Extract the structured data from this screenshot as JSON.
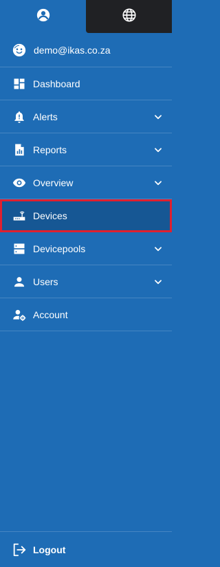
{
  "tabs": [
    {
      "icon": "account-circle-icon"
    },
    {
      "icon": "globe-icon"
    }
  ],
  "user": {
    "email": "demo@ikas.co.za",
    "icon": "smiley-avatar-icon"
  },
  "nav": {
    "items": [
      {
        "label": "Dashboard",
        "icon": "dashboard-icon",
        "expandable": false
      },
      {
        "label": "Alerts",
        "icon": "bell-alert-icon",
        "expandable": true
      },
      {
        "label": "Reports",
        "icon": "report-document-icon",
        "expandable": true
      },
      {
        "label": "Overview",
        "icon": "eye-icon",
        "expandable": true
      },
      {
        "label": "Devices",
        "icon": "router-icon",
        "expandable": false,
        "active": true
      },
      {
        "label": "Devicepools",
        "icon": "server-icon",
        "expandable": true
      },
      {
        "label": "Users",
        "icon": "person-icon",
        "expandable": true
      },
      {
        "label": "Account",
        "icon": "user-settings-icon",
        "expandable": false
      }
    ]
  },
  "logout": {
    "label": "Logout",
    "icon": "logout-icon"
  },
  "colors": {
    "sidebar": "#1e6cb5",
    "active": "#165794",
    "highlight_border": "#e0202f",
    "dark_tab": "#202124"
  }
}
